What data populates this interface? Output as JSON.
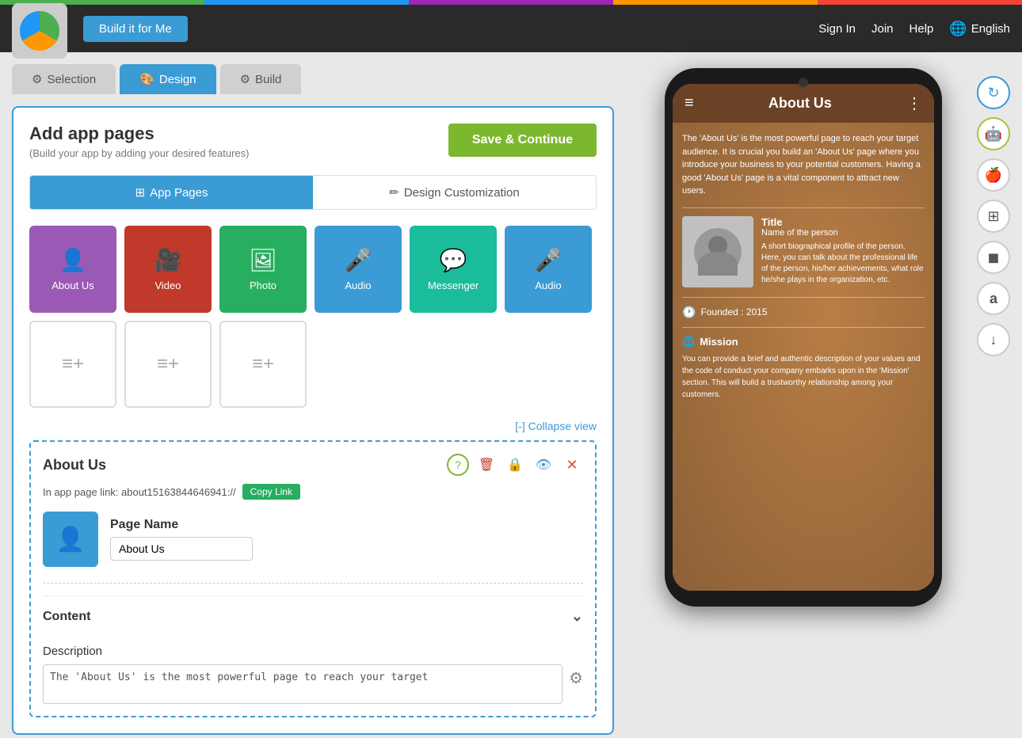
{
  "top_bar": {
    "build_btn": "Build it for Me",
    "sign_in": "Sign In",
    "join": "Join",
    "help": "Help",
    "language": "English"
  },
  "tabs": {
    "selection": "Selection",
    "design": "Design",
    "build": "Build"
  },
  "card": {
    "title": "Add app pages",
    "subtitle": "(Build your app by adding your desired features)",
    "save_btn": "Save & Continue"
  },
  "sub_tabs": {
    "app_pages": "App Pages",
    "design_customization": "Design Customization"
  },
  "page_tiles": [
    {
      "label": "About Us",
      "color": "purple",
      "icon": "👤"
    },
    {
      "label": "Video",
      "color": "red",
      "icon": "🎥"
    },
    {
      "label": "Photo",
      "color": "green",
      "icon": "🖼"
    },
    {
      "label": "Audio",
      "color": "blue",
      "icon": "🎤"
    },
    {
      "label": "Messenger",
      "color": "teal",
      "icon": "💬"
    },
    {
      "label": "Audio",
      "color": "blue",
      "icon": "🎤"
    }
  ],
  "collapse": "[-] Collapse view",
  "about_section": {
    "title": "About Us",
    "link_label": "In app page link: about15163844646941://",
    "copy_btn": "Copy Link",
    "page_name_label": "Page Name",
    "page_name_value": "About Us"
  },
  "content": {
    "label": "Content",
    "description_label": "Description",
    "description_value": "The 'About Us' is the most powerful page to reach your target"
  },
  "phone": {
    "app_title": "About Us",
    "about_text": "The 'About Us' is the most powerful page to reach your target audience. It is crucial you build an 'About Us' page where you introduce your business to your potential customers. Having a good 'About Us' page is a vital component to attract new users.",
    "profile_title": "Title",
    "profile_name": "Name of the person",
    "profile_desc": "A short biographical profile of the person. Here, you can talk about the professional life of the person, his/her achievements, what role he/she plays in the organization, etc.",
    "founded": "Founded : 2015",
    "mission_title": "Mission",
    "mission_text": "You can provide a brief and authentic description of your values and the code of conduct your company embarks upon in the 'Mission' section. This will build a trustworthy relationship among your customers."
  },
  "side_buttons": [
    {
      "label": "refresh-icon",
      "symbol": "↻",
      "class": "refresh"
    },
    {
      "label": "android-icon",
      "symbol": "🤖",
      "class": "active-android"
    },
    {
      "label": "apple-icon",
      "symbol": "🍎",
      "class": ""
    },
    {
      "label": "windows-icon",
      "symbol": "⊞",
      "class": ""
    },
    {
      "label": "blackberry-icon",
      "symbol": "◼",
      "class": ""
    },
    {
      "label": "amazon-icon",
      "symbol": "a",
      "class": ""
    },
    {
      "label": "download-icon",
      "symbol": "↓",
      "class": ""
    }
  ]
}
